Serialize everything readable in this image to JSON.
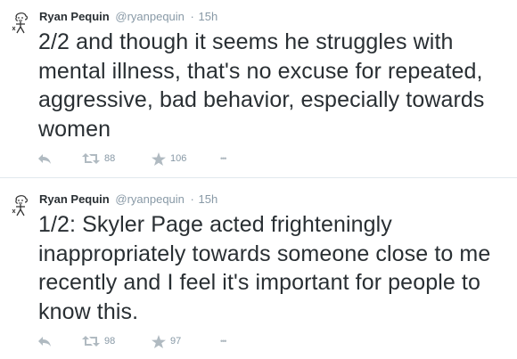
{
  "tweets": [
    {
      "name": "Ryan Pequin",
      "handle": "@ryanpequin",
      "separator": "·",
      "time": "15h",
      "text": "2/2 and though it seems he struggles with mental illness, that's no excuse for repeated, aggressive, bad behavior, especially towards women",
      "retweets": "88",
      "favorites": "106",
      "more": "•••"
    },
    {
      "name": "Ryan Pequin",
      "handle": "@ryanpequin",
      "separator": "·",
      "time": "15h",
      "text": "1/2: Skyler Page acted frighteningly inappropriately towards someone close to me recently and I feel it's important for people to know this.",
      "retweets": "98",
      "favorites": "97",
      "more": "•••"
    }
  ],
  "icons": [
    "reply-icon",
    "retweet-icon",
    "favorite-star-icon",
    "more-dots-icon"
  ],
  "colors": {
    "text": "#292f33",
    "muted": "#8899a6",
    "icon": "#b0bac1",
    "divider": "#e1e8ed"
  }
}
